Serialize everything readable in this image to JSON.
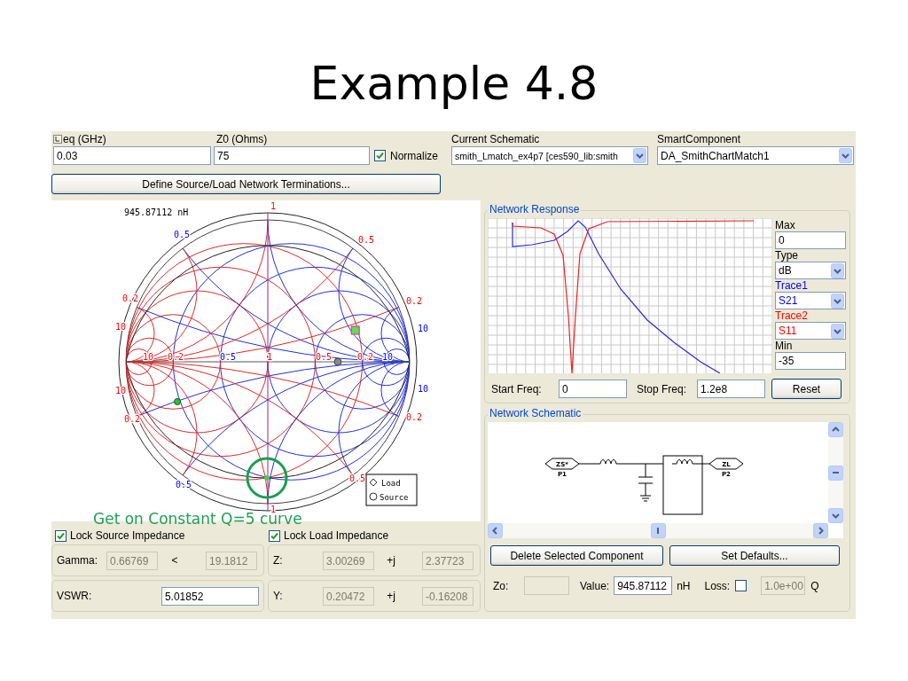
{
  "title": "Example 4.8",
  "settings": {
    "freq_label": "eq (GHz)",
    "freq_value": "0.03",
    "z0_label": "Z0 (Ohms)",
    "z0_value": "75",
    "normalize": {
      "label": "Normalize",
      "checked": true
    },
    "schematic_label": "Current Schematic",
    "schematic_value": "smith_Lmatch_ex4p7 [ces590_lib:smith",
    "component_label": "SmartComponent",
    "component_value": "DA_SmithChartMatch1"
  },
  "define_button": "Define Source/Load Network Terminations...",
  "smith_chart": {
    "readout": "945.87112 nH",
    "labels": [
      {
        "text": "1",
        "color": "#ff0000"
      },
      {
        "text": "0.5",
        "color": "#0000ff"
      },
      {
        "text": "0.5",
        "color": "#ff0000"
      },
      {
        "text": "0.2",
        "color": "#ff0000"
      },
      {
        "text": "10",
        "color": "#ff0000"
      },
      {
        "text": "0.2",
        "color": "#ff0000"
      },
      {
        "text": "10",
        "color": "#0000ff"
      },
      {
        "text": "10",
        "color": "#ff0000"
      },
      {
        "text": "0.2",
        "color": "#ff0000"
      },
      {
        "text": "10",
        "color": "#0000ff"
      },
      {
        "text": "0.2",
        "color": "#ff0000"
      },
      {
        "text": "0.5",
        "color": "#0000ff"
      },
      {
        "text": "0.5",
        "color": "#ff0000"
      },
      {
        "text": "1",
        "color": "#ff0000"
      },
      {
        "text": "10",
        "color": "#ff0000"
      },
      {
        "text": "0.2",
        "color": "#ff0000"
      },
      {
        "text": "0.5",
        "color": "#0000ff"
      },
      {
        "text": "1",
        "color": "#ff0000"
      },
      {
        "text": "0.5",
        "color": "#ff0000"
      },
      {
        "text": "0.2",
        "color": "#ff0000"
      },
      {
        "text": "10",
        "color": "#0000ff"
      }
    ],
    "legend": [
      "Load",
      "Source"
    ]
  },
  "annotation": "Get on Constant Q=5 curve",
  "locks": [
    {
      "label": "Lock Source Impedance",
      "checked": true
    },
    {
      "label": "Lock Load Impedance",
      "checked": true
    }
  ],
  "source_rows": [
    {
      "label": "Gamma:",
      "separator": "<",
      "fields": [
        {
          "value": "0.66769",
          "disabled": true
        },
        {
          "value": "19.1812",
          "disabled": true
        }
      ]
    },
    {
      "label": "VSWR:",
      "fields": [
        {
          "value": "5.01852",
          "disabled": false
        }
      ]
    }
  ],
  "load_rows": [
    {
      "label": "Z:",
      "separator": "+j",
      "fields": [
        {
          "value": "3.00269",
          "disabled": true
        },
        {
          "value": "2.37723",
          "disabled": true
        }
      ]
    },
    {
      "label": "Y:",
      "separator": "+j",
      "fields": [
        {
          "value": "0.20472",
          "disabled": true
        },
        {
          "value": "-0.16208",
          "disabled": true
        }
      ]
    }
  ],
  "network_response": {
    "title": "Network Response",
    "max_label": "Max",
    "max_value": "0",
    "type_label": "Type",
    "type_value": "dB",
    "traces": [
      {
        "label": "Trace1",
        "value": "S21",
        "color": "#0000ff"
      },
      {
        "label": "Trace2",
        "value": "S11",
        "color": "#ff0000"
      }
    ],
    "min_label": "Min",
    "min_value": "-35",
    "start_label": "Start Freq:",
    "start_value": "0",
    "stop_label": "Stop Freq:",
    "stop_value": "1.2e8",
    "reset": "Reset"
  },
  "network_schematic": {
    "title": "Network Schematic",
    "ports": [
      {
        "name": "ZS*",
        "pin": "P1"
      },
      {
        "name": "ZL",
        "pin": "P2"
      }
    ],
    "buttons": [
      "Delete Selected Component",
      "Set Defaults..."
    ],
    "zo_label": "Zo:",
    "value_label": "Value:",
    "value": "945.87112",
    "unit": "nH",
    "loss_label": "Loss:",
    "loss_checked": false,
    "q": {
      "value": "1.0e+00",
      "disabled": true
    },
    "q_label": "Q"
  }
}
